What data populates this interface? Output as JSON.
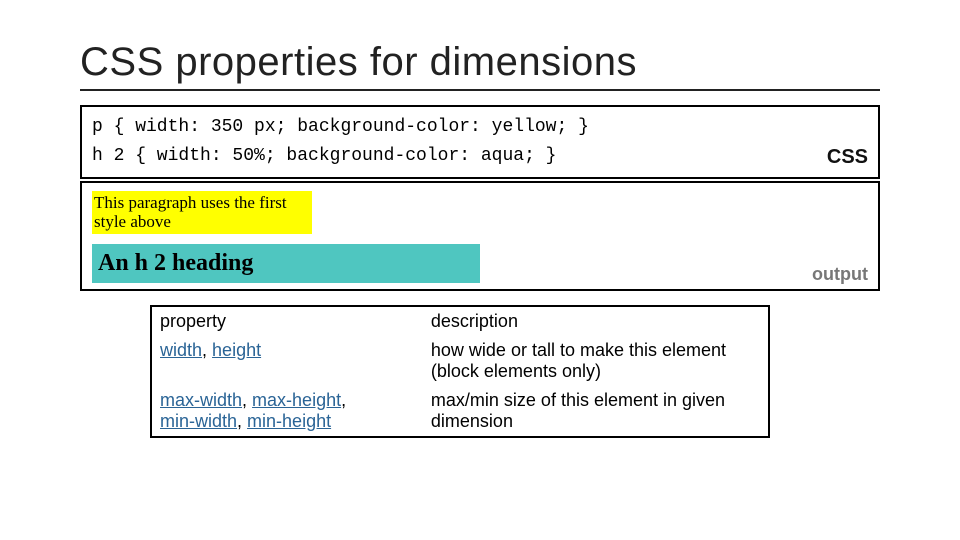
{
  "title": "CSS properties for dimensions",
  "code": {
    "line1": "p { width: 350 px; background-color: yellow; }",
    "line2": "h 2 { width: 50%; background-color: aqua; }",
    "label": "CSS"
  },
  "output": {
    "paragraph": "This paragraph uses the first style above",
    "heading": "An h 2 heading",
    "label": "output"
  },
  "table": {
    "header": {
      "c1": "property",
      "c2": "description"
    },
    "rows": [
      {
        "props": [
          "width",
          "height"
        ],
        "desc": "how wide or tall to make this element (block elements only)"
      },
      {
        "props": [
          "max-width",
          "max-height",
          "min-width",
          "min-height"
        ],
        "desc": "max/min size of this element in given dimension"
      }
    ]
  }
}
